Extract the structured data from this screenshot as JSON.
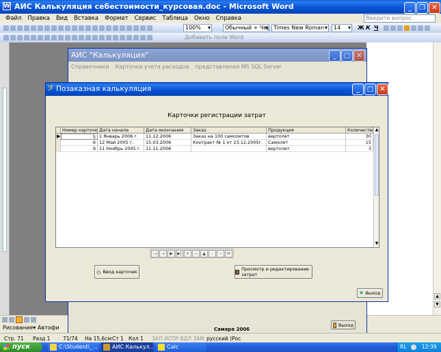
{
  "word": {
    "title": "АИС Калькуляция себестоимости_курсовая.doc - Microsoft Word",
    "menu": [
      "Файл",
      "Правка",
      "Вид",
      "Вставка",
      "Формат",
      "Сервис",
      "Таблица",
      "Окно",
      "Справка"
    ],
    "help_placeholder": "Введите вопрос",
    "zoom": "100%",
    "style": "Обычный + Чер",
    "font": "Times New Roman",
    "size": "14",
    "fmt_buttons": [
      "Ж",
      "К",
      "Ч"
    ],
    "add_field": "Добавить поле Word",
    "draw_label": "Рисование",
    "autoshapes": "Автофи",
    "status": {
      "page": "Стр. 71",
      "section": "Разд 1",
      "pages": "71/74",
      "pos": "На 15,6см",
      "line": "Ст 1",
      "col": "Кол 1",
      "modes": "ЗАП ИСПР ВДЛ ЗАМ",
      "lang": "русский (Рос"
    }
  },
  "ais": {
    "title": "АИС \"Калькуляция\"",
    "menu": [
      "Справочники",
      "Карточка учета расходов",
      "представления MS SQL Server"
    ],
    "footer": "Самара 2006",
    "exit": "Выход"
  },
  "form": {
    "title": "Позаказная калькуляция",
    "heading": "Карточки регистрации затрат",
    "columns": [
      "Номер карточки",
      "Дата начала",
      "Дата окончания",
      "Заказ",
      "Продукция",
      "Количество"
    ],
    "rows": [
      [
        "5",
        "1 Январь 2006 г.",
        "11.12.2006",
        "Заказ на 100 самолетов",
        "вертолет",
        "30"
      ],
      [
        "6",
        "12 Май 2005 г.",
        "15.03.2006",
        "Контракт № 1 от 23.12.2005г.",
        "Самолет",
        "15"
      ],
      [
        "9",
        "11 Ноябрь 2005 г.",
        "11.11.2006",
        "",
        "вертолет",
        "3"
      ]
    ],
    "nav": [
      "|◀",
      "◀",
      "▶",
      "▶|",
      "+",
      "−",
      "▲",
      "✓",
      "✕",
      "⟳"
    ],
    "btn_input": "Ввод карточек",
    "btn_view": "Просмотр и редактирование затрат",
    "btn_exit": "Выход"
  },
  "taskbar": {
    "start": "пуск",
    "items": [
      "C:\\Student\\_...",
      "АИС Калькул...",
      "Calc"
    ],
    "lang": "RL",
    "time": "12:39"
  }
}
